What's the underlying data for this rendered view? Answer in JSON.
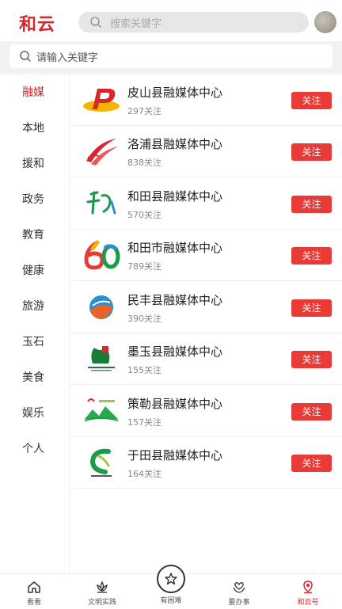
{
  "header": {
    "logo": "和云",
    "search_placeholder": "搜索关键字"
  },
  "filter": {
    "placeholder": "请输入关键字"
  },
  "sidebar": {
    "items": [
      {
        "label": "融媒"
      },
      {
        "label": "本地"
      },
      {
        "label": "援和"
      },
      {
        "label": "政务"
      },
      {
        "label": "教育"
      },
      {
        "label": "健康"
      },
      {
        "label": "旅游"
      },
      {
        "label": "玉石"
      },
      {
        "label": "美食"
      },
      {
        "label": "娱乐"
      },
      {
        "label": "个人"
      }
    ],
    "active": "融媒"
  },
  "list": {
    "follow_label": "关注",
    "items": [
      {
        "name": "皮山县融媒体中心",
        "count": "297关注",
        "logo": "red-yellow-p-logo"
      },
      {
        "name": "洛浦县融媒体中心",
        "count": "838关注",
        "logo": "red-swoosh-logo"
      },
      {
        "name": "和田县融媒体中心",
        "count": "570关注",
        "logo": "green-calligraphy-logo"
      },
      {
        "name": "和田市融媒体中心",
        "count": "789关注",
        "logo": "multicolor-60-logo"
      },
      {
        "name": "民丰县融媒体中心",
        "count": "390关注",
        "logo": "blue-orange-circle-logo"
      },
      {
        "name": "墨玉县融媒体中心",
        "count": "155关注",
        "logo": "green-red-emblem-logo"
      },
      {
        "name": "策勒县融媒体中心",
        "count": "157关注",
        "logo": "green-mountain-logo"
      },
      {
        "name": "于田县融媒体中心",
        "count": "164关注",
        "logo": "green-c-logo"
      }
    ]
  },
  "tabbar": {
    "items": [
      {
        "label": "看看",
        "icon": "home-icon"
      },
      {
        "label": "文明实践",
        "icon": "lotus-icon"
      },
      {
        "label": "有困难",
        "icon": "star-circle-icon"
      },
      {
        "label": "要办事",
        "icon": "hands-icon"
      },
      {
        "label": "和云号",
        "icon": "location-pin-icon"
      }
    ],
    "active": "和云号"
  },
  "colors": {
    "brand": "#d8262c",
    "follow_button": "#e83a37"
  }
}
